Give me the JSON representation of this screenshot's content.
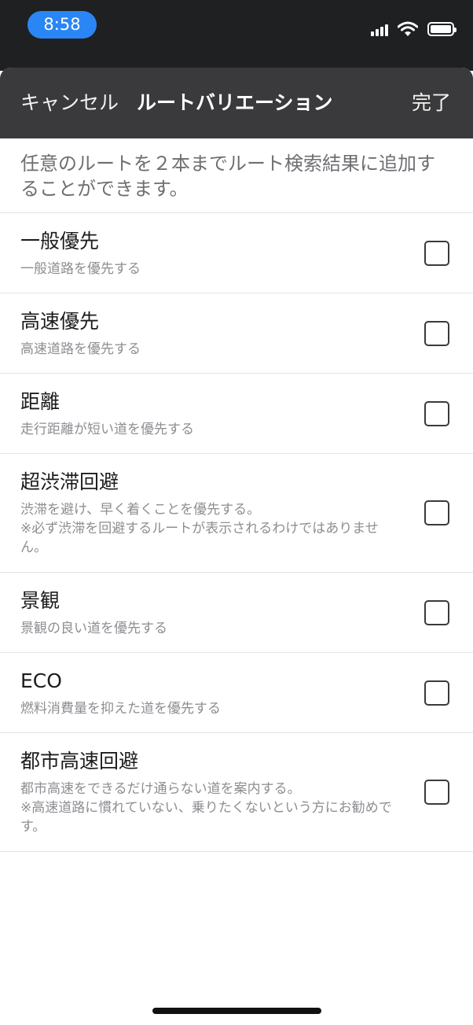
{
  "status_bar": {
    "time": "8:58",
    "icons": [
      "cellular-signal-icon",
      "wifi-icon",
      "battery-icon"
    ]
  },
  "nav": {
    "cancel_label": "キャンセル",
    "title": "ルートバリエーション",
    "done_label": "完了"
  },
  "description": "任意のルートを２本までルート検索結果に追加することができます。",
  "options": [
    {
      "title": "一般優先",
      "description": "一般道路を優先する",
      "checked": false
    },
    {
      "title": "高速優先",
      "description": "高速道路を優先する",
      "checked": false
    },
    {
      "title": "距離",
      "description": "走行距離が短い道を優先する",
      "checked": false
    },
    {
      "title": "超渋滞回避",
      "description": "渋滞を避け、早く着くことを優先する。\n※必ず渋滞を回避するルートが表示されるわけではありません。",
      "checked": false
    },
    {
      "title": "景観",
      "description": "景観の良い道を優先する",
      "checked": false
    },
    {
      "title": "ECO",
      "description": "燃料消費量を抑えた道を優先する",
      "checked": false
    },
    {
      "title": "都市高速回避",
      "description": "都市高速をできるだけ通らない道を案内する。\n※高速道路に慣れていない、乗りたくないという方にお勧めです。",
      "checked": false
    }
  ],
  "colors": {
    "time_pill": "#2a86f5",
    "nav_bar": "#3a3a3c",
    "status_bar": "#1f2021"
  }
}
